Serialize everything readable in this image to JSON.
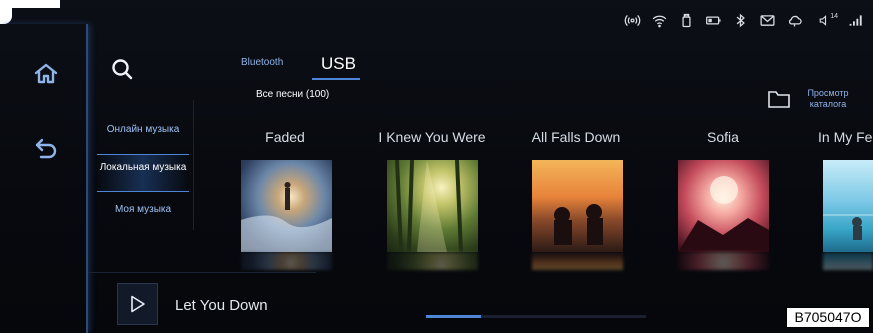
{
  "status_bar": {
    "icons": [
      "hotspot-icon",
      "wifi-icon",
      "usb-icon",
      "battery-icon",
      "bluetooth-icon",
      "mail-icon",
      "cloud-icon",
      "volume-icon",
      "signal-icon"
    ],
    "volume_level": "14"
  },
  "rail": {
    "icons": [
      "home-icon",
      "back-icon"
    ]
  },
  "menu": {
    "search_icon": "search-icon",
    "items": [
      {
        "label": "Онлайн музыка",
        "selected": false
      },
      {
        "label": "Локальная музыка",
        "selected": true
      },
      {
        "label": "Моя музыка",
        "selected": false
      }
    ]
  },
  "source_tabs": [
    {
      "label": "Bluetooth",
      "selected": false
    },
    {
      "label": "USB",
      "selected": true
    }
  ],
  "all_songs_label": "Все песни (100)",
  "browse": {
    "icon": "folder-icon",
    "label": "Просмотр каталога"
  },
  "albums": [
    {
      "title": "Faded"
    },
    {
      "title": "I Knew You Were"
    },
    {
      "title": "All Falls Down"
    },
    {
      "title": "Sofia"
    },
    {
      "title": "In My Fe"
    }
  ],
  "now_playing": {
    "icon": "play-icon",
    "title": "Let You Down"
  },
  "scroll_position": 0.25,
  "reference_code": "B705047O",
  "colors": {
    "accent": "#4d86d6",
    "accent_text": "#8fb4ea",
    "background": "#07090e"
  }
}
